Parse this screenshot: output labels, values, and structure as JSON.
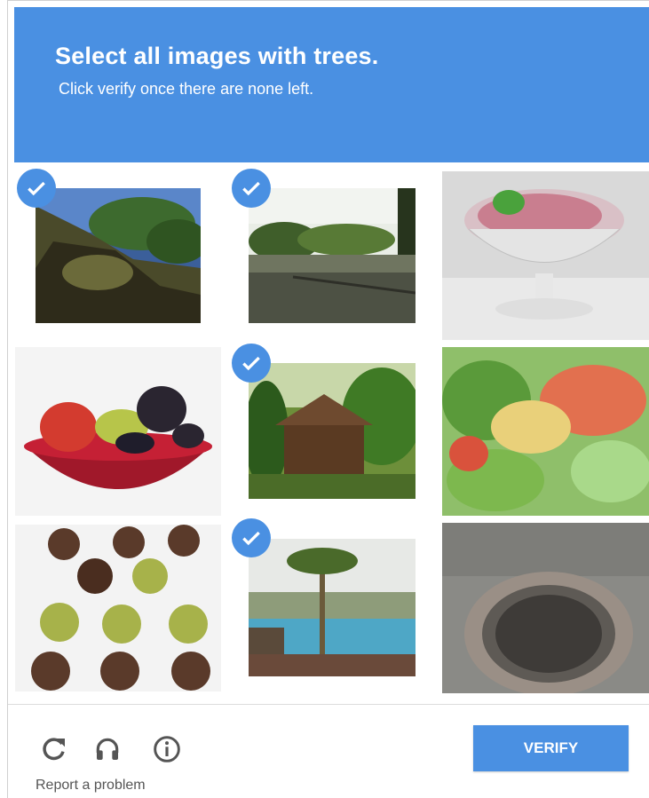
{
  "header": {
    "prompt_prefix": "Select all images with ",
    "prompt_target": "trees.",
    "subtitle": "Click verify once there are none left."
  },
  "tiles": [
    {
      "label": "rock-with-trees",
      "selected": true
    },
    {
      "label": "pond-with-trees",
      "selected": true
    },
    {
      "label": "ice-cream-dessert",
      "selected": false
    },
    {
      "label": "fruit-bowl",
      "selected": false
    },
    {
      "label": "house-with-trees",
      "selected": true
    },
    {
      "label": "salad",
      "selected": false
    },
    {
      "label": "truffles",
      "selected": false
    },
    {
      "label": "pool-with-palm-tree",
      "selected": true
    },
    {
      "label": "survey-marker",
      "selected": false
    }
  ],
  "footer": {
    "icons": [
      "reload-icon",
      "headphones-icon",
      "info-icon"
    ],
    "report_label": "Report a problem",
    "verify_label": "VERIFY"
  },
  "colors": {
    "accent": "#4a90e2"
  }
}
